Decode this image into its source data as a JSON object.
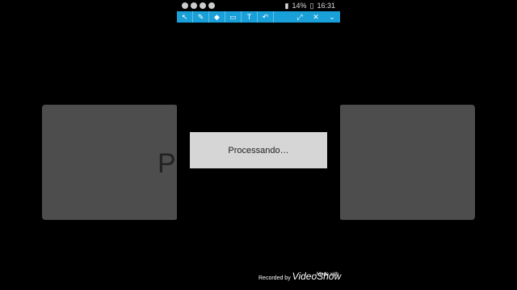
{
  "status": {
    "battery": "14%",
    "time": "16:31"
  },
  "dialog": {
    "message": "Processando…"
  },
  "background": {
    "text": "P"
  },
  "watermark": {
    "recorded_by": "Recorded by",
    "made_with": "Made with",
    "brand": "VideoShow"
  },
  "colors": {
    "toolbar": "#1aa0d8",
    "dialog": "#d6d6d6",
    "panel": "#4d4d4d"
  }
}
